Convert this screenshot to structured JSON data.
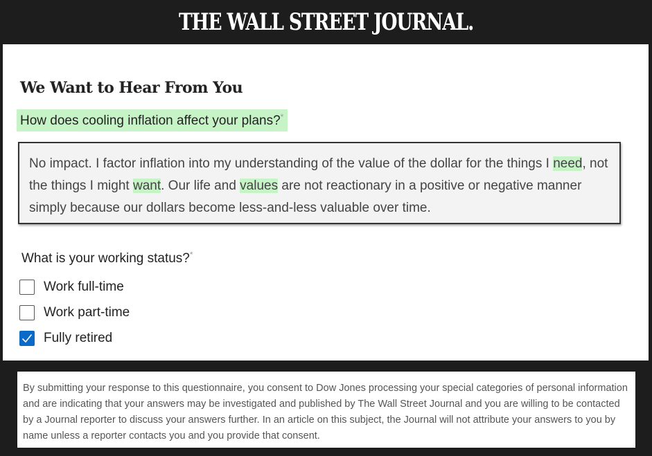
{
  "masthead": {
    "logo_text": "THE WALL STREET JOURNAL."
  },
  "form": {
    "heading": "We Want to Hear From You",
    "question1": {
      "label": "How does cooling inflation affect your plans?",
      "required_marker": "*",
      "answer_parts": [
        {
          "text": "No impact. I factor inflation into my understanding of the value of the dollar for the things I ",
          "highlight": false
        },
        {
          "text": "need",
          "highlight": true
        },
        {
          "text": ", not the things I might ",
          "highlight": false
        },
        {
          "text": "want",
          "highlight": true
        },
        {
          "text": ". Our life and ",
          "highlight": false
        },
        {
          "text": "values",
          "highlight": true
        },
        {
          "text": " are not reactionary in a positive or negative manner simply because our dollars become less-and-less valuable over time.",
          "highlight": false
        }
      ]
    },
    "question2": {
      "label": "What is your working status?",
      "required_marker": "*",
      "options": [
        {
          "label": "Work full-time",
          "checked": false
        },
        {
          "label": "Work part-time",
          "checked": false
        },
        {
          "label": "Fully retired",
          "checked": true
        }
      ]
    }
  },
  "footer": {
    "consent_text": "By submitting your response to this questionnaire, you consent to Dow Jones processing your special categories of personal information and are indicating that your answers may be investigated and published by The Wall Street Journal and you are willing to be contacted by a Journal reporter to discuss your answers further. In an article on this subject, the Journal will not attribute your answers to you by name unless a reporter contacts you and you provide that consent."
  },
  "colors": {
    "highlight": "#c7f4c7",
    "checkbox_checked": "#0b69c7",
    "masthead_bg": "#1d1d1d"
  }
}
